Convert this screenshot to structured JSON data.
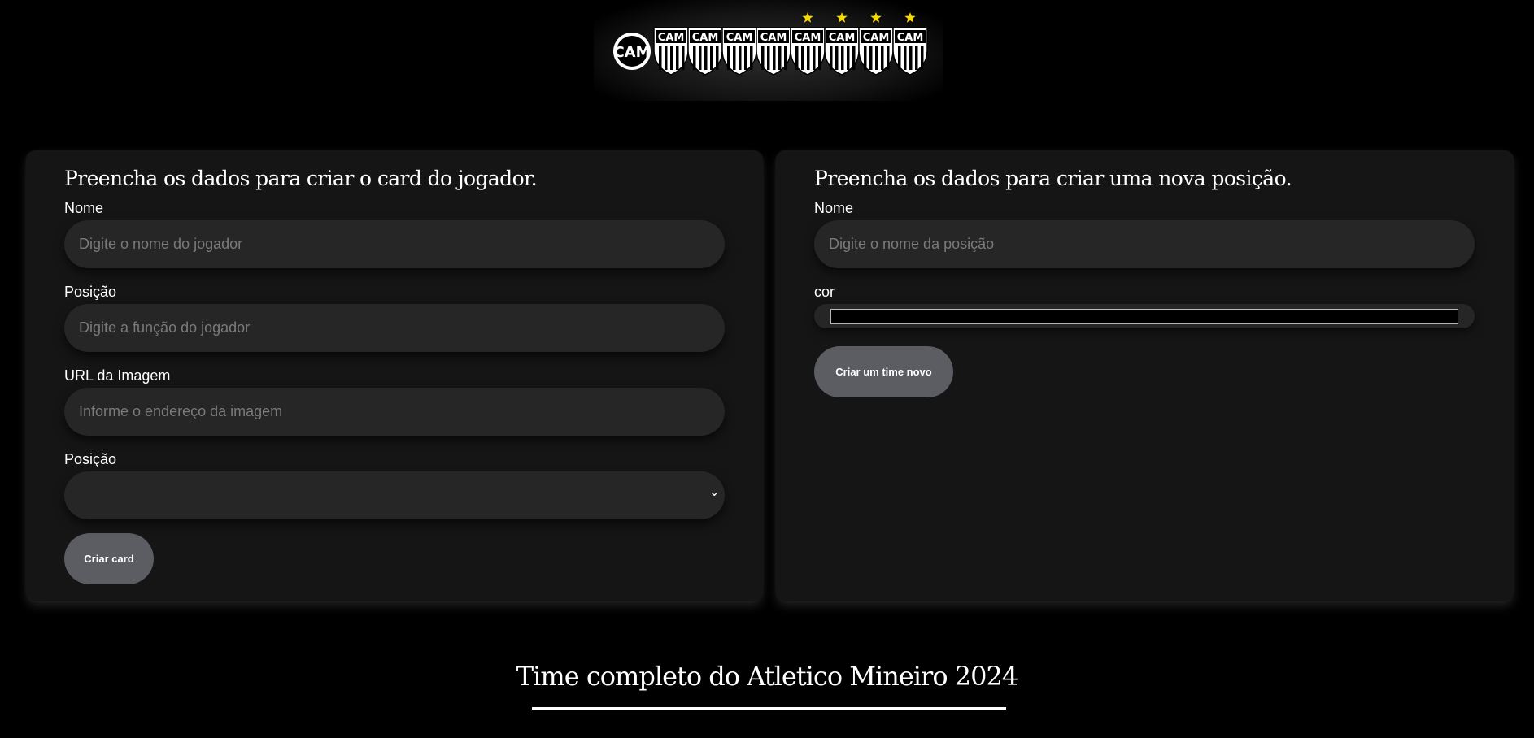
{
  "banner": {
    "crests": [
      "CAM",
      "CAM",
      "CAM",
      "CAM",
      "CAM",
      "CAM",
      "CAM",
      "CAM"
    ],
    "star_color": "#f5d90a",
    "star_count": 4,
    "icon": "atletico-crests-banner"
  },
  "player_form": {
    "title": "Preencha os dados para criar o card do jogador.",
    "name": {
      "label": "Nome",
      "placeholder": "Digite o nome do jogador",
      "value": ""
    },
    "role": {
      "label": "Posição",
      "placeholder": "Digite a função do jogador",
      "value": ""
    },
    "image": {
      "label": "URL da Imagem",
      "placeholder": "Informe o endereço da imagem",
      "value": ""
    },
    "position_select": {
      "label": "Posição",
      "selected": "",
      "chevron": "⌄"
    },
    "submit_label": "Criar card"
  },
  "position_form": {
    "title": "Preencha os dados para criar uma nova posição.",
    "name": {
      "label": "Nome",
      "placeholder": "Digite o nome da posição",
      "value": ""
    },
    "color": {
      "label": "cor",
      "value": "#000000"
    },
    "submit_label": "Criar um time novo"
  },
  "team_section": {
    "title": "Time completo do Atletico Mineiro 2024"
  },
  "colors": {
    "background": "#000000",
    "panel": "#151515",
    "input": "#262626",
    "button": "#5b5d63",
    "text": "#ffffff",
    "placeholder": "#7a7a7a"
  }
}
